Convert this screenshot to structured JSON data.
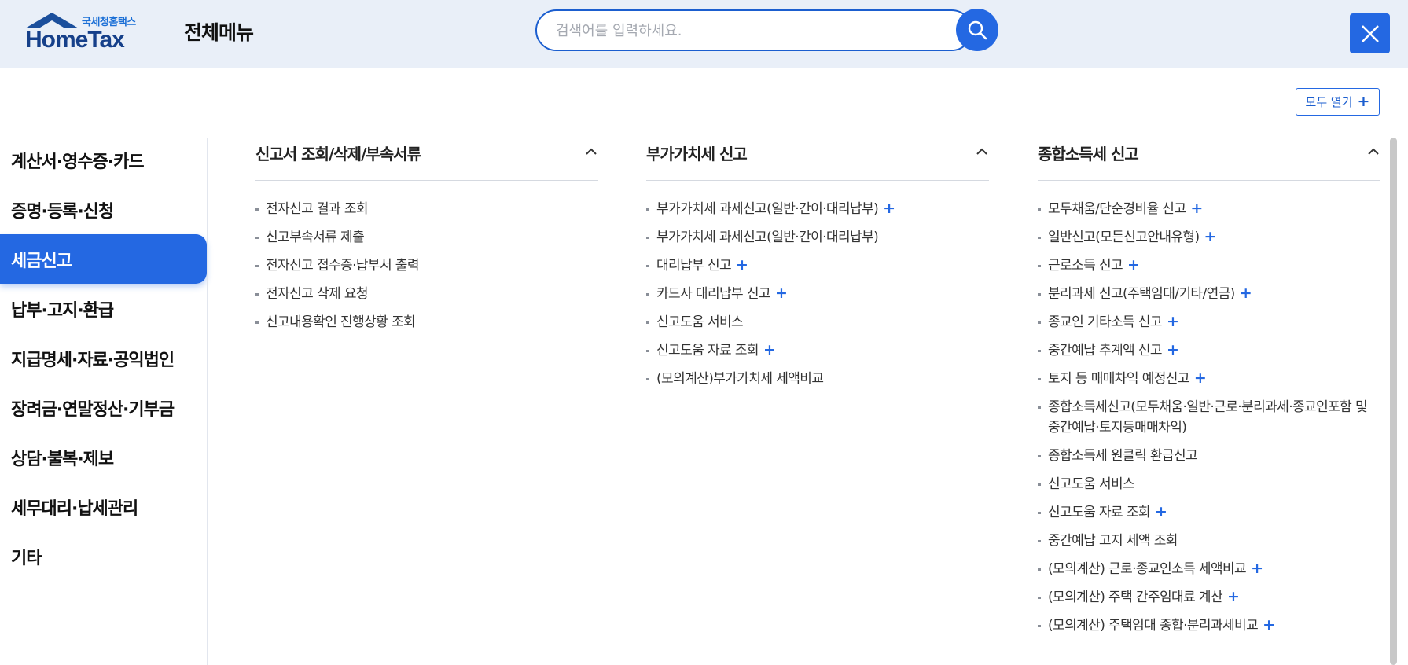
{
  "header": {
    "logo_sub": "국세청홈택스",
    "logo_main": "HomeTax",
    "title": "전체메뉴",
    "search_placeholder": "검색어를 입력하세요.",
    "open_all_label": "모두 열기"
  },
  "colors": {
    "accent": "#2468e2",
    "header_bg": "#e9eff8",
    "logo": "#16408a"
  },
  "sidebar": {
    "active_index": 2,
    "items": [
      "계산서·영수증·카드",
      "증명·등록·신청",
      "세금신고",
      "납부·고지·환급",
      "지급명세·자료·공익법인",
      "장려금·연말정산·기부금",
      "상담·불복·제보",
      "세무대리·납세관리",
      "기타"
    ]
  },
  "columns": [
    {
      "title": "신고서 조회/삭제/부속서류",
      "items": [
        {
          "label": "전자신고 결과 조회",
          "expandable": false
        },
        {
          "label": "신고부속서류 제출",
          "expandable": false
        },
        {
          "label": "전자신고 접수증·납부서 출력",
          "expandable": false
        },
        {
          "label": "전자신고 삭제 요청",
          "expandable": false
        },
        {
          "label": "신고내용확인 진행상황 조회",
          "expandable": false
        }
      ]
    },
    {
      "title": "부가가치세 신고",
      "items": [
        {
          "label": "부가가치세 과세신고(일반·간이·대리납부)",
          "expandable": true
        },
        {
          "label": "부가가치세 과세신고(일반·간이·대리납부)",
          "expandable": false
        },
        {
          "label": "대리납부 신고",
          "expandable": true
        },
        {
          "label": "카드사 대리납부 신고",
          "expandable": true
        },
        {
          "label": "신고도움 서비스",
          "expandable": false
        },
        {
          "label": "신고도움 자료 조회",
          "expandable": true
        },
        {
          "label": "(모의계산)부가가치세 세액비교",
          "expandable": false
        }
      ]
    },
    {
      "title": "종합소득세 신고",
      "items": [
        {
          "label": "모두채움/단순경비율 신고",
          "expandable": true
        },
        {
          "label": "일반신고(모든신고안내유형)",
          "expandable": true
        },
        {
          "label": "근로소득 신고",
          "expandable": true
        },
        {
          "label": "분리과세 신고(주택임대/기타/연금)",
          "expandable": true
        },
        {
          "label": "종교인 기타소득 신고",
          "expandable": true
        },
        {
          "label": "중간예납 추계액 신고",
          "expandable": true
        },
        {
          "label": "토지 등 매매차익 예정신고",
          "expandable": true
        },
        {
          "label": "종합소득세신고(모두채움·일반·근로·분리과세·종교인포함 및 중간예납·토지등매매차익)",
          "expandable": false
        },
        {
          "label": "종합소득세 원클릭 환급신고",
          "expandable": false
        },
        {
          "label": "신고도움 서비스",
          "expandable": false
        },
        {
          "label": "신고도움 자료 조회",
          "expandable": true
        },
        {
          "label": "중간예납 고지 세액 조회",
          "expandable": false
        },
        {
          "label": "(모의계산) 근로·종교인소득 세액비교",
          "expandable": true
        },
        {
          "label": "(모의계산) 주택 간주임대료 계산",
          "expandable": true
        },
        {
          "label": "(모의계산) 주택임대 종합·분리과세비교",
          "expandable": true
        }
      ]
    }
  ]
}
